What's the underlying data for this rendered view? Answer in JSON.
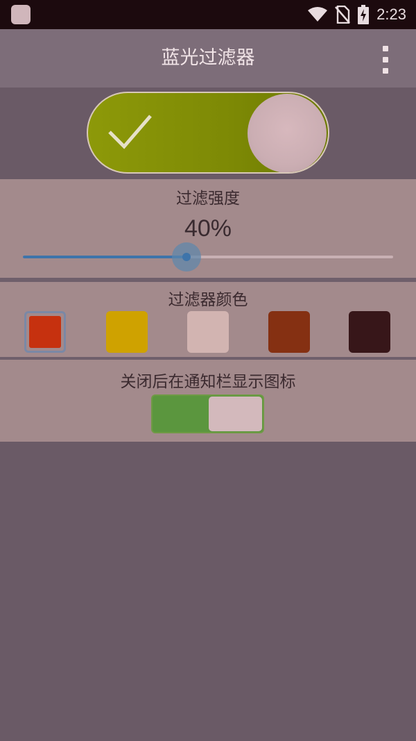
{
  "status_bar": {
    "time": "2:23",
    "icons": [
      "app-notification-icon",
      "wifi-icon",
      "no-sim-icon",
      "battery-charging-icon"
    ]
  },
  "app_bar": {
    "title": "蓝光过滤器",
    "overflow_icon": "more-vertical-icon"
  },
  "main_switch": {
    "state": "on",
    "icon": "check-icon",
    "colors": {
      "on_track": "#7d8905",
      "knob": "#cbaeb3"
    }
  },
  "intensity": {
    "title": "过滤强度",
    "value_text": "40%",
    "value": 40,
    "min": 0,
    "max": 100,
    "accent": "#3e74aa"
  },
  "filter_color": {
    "title": "过滤器颜色",
    "selected_index": 0,
    "swatches": [
      {
        "name": "red",
        "color": "#c6310f"
      },
      {
        "name": "yellow",
        "color": "#cfa200"
      },
      {
        "name": "light-pink",
        "color": "#d2b4b1"
      },
      {
        "name": "brown",
        "color": "#853012"
      },
      {
        "name": "dark-brown",
        "color": "#371619"
      }
    ]
  },
  "notify_icon": {
    "title": "关闭后在通知栏显示图标",
    "state": "on",
    "colors": {
      "track": "#5b963e",
      "knob": "#d3b9bc"
    }
  }
}
